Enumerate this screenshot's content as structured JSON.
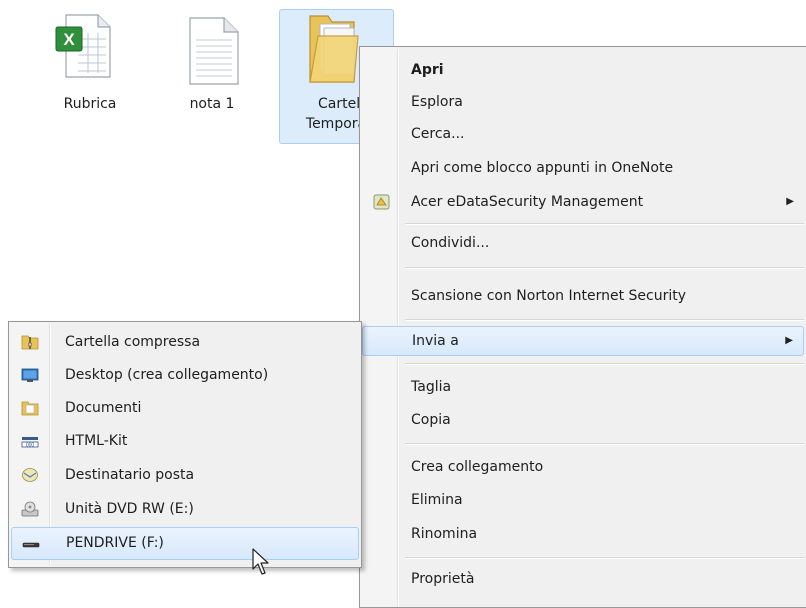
{
  "desktop": {
    "icons": [
      {
        "label": "Rubrica",
        "icon": "excel-file-icon"
      },
      {
        "label": "nota 1",
        "icon": "text-file-icon"
      },
      {
        "label_line1": "Cartell",
        "label_line2": "Tempora",
        "icon": "folder-icon"
      }
    ]
  },
  "context_menu": {
    "items": [
      {
        "label": "Apri",
        "bold": true
      },
      {
        "label": "Esplora"
      },
      {
        "label": "Cerca..."
      },
      {
        "label": "Apri come blocco appunti in OneNote"
      },
      {
        "label": "Acer eDataSecurity Management",
        "icon": "acer-security-icon",
        "submenu": true
      },
      {
        "label": "Condividi..."
      },
      {
        "label": "Scansione con Norton Internet Security"
      },
      {
        "label": "Invia a",
        "submenu": true,
        "highlighted": true
      },
      {
        "label": "Taglia"
      },
      {
        "label": "Copia"
      },
      {
        "label": "Crea collegamento"
      },
      {
        "label": "Elimina"
      },
      {
        "label": "Rinomina"
      },
      {
        "label": "Proprietà"
      }
    ],
    "arrow_glyph": "▶"
  },
  "send_to_menu": {
    "items": [
      {
        "label": "Cartella compressa",
        "icon": "zip-folder-icon"
      },
      {
        "label": "Desktop (crea collegamento)",
        "icon": "desktop-icon"
      },
      {
        "label": "Documenti",
        "icon": "documents-folder-icon"
      },
      {
        "label": "HTML-Kit",
        "icon": "html-kit-icon"
      },
      {
        "label": "Destinatario posta",
        "icon": "mail-recipient-icon"
      },
      {
        "label": "Unità DVD RW (E:)",
        "icon": "dvd-drive-icon"
      },
      {
        "label": "PENDRIVE (F:)",
        "icon": "usb-drive-icon",
        "highlighted": true
      }
    ]
  },
  "colors": {
    "highlight_bg": "#d7e9fc",
    "highlight_border": "#a9cff2",
    "menu_bg": "#f0f0f0"
  }
}
